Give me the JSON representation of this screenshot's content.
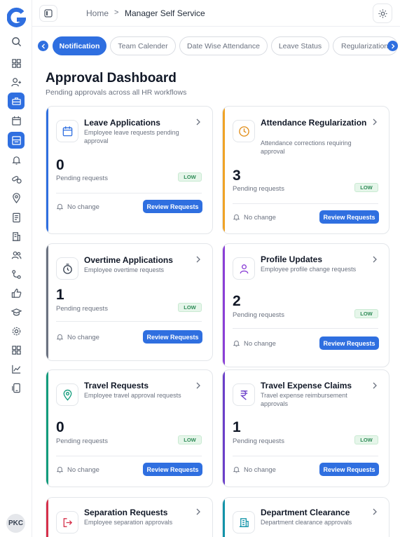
{
  "sidebar": {
    "logo_letter": "G",
    "avatar_initials": "PKC",
    "icons": [
      {
        "name": "search-icon"
      },
      {
        "name": "dashboard-icon"
      },
      {
        "name": "add-user-icon"
      },
      {
        "name": "briefcase-icon",
        "active": true
      },
      {
        "name": "calendar-icon"
      },
      {
        "name": "inbox-icon",
        "active": true
      },
      {
        "name": "bell-icon"
      },
      {
        "name": "pills-icon"
      },
      {
        "name": "location-icon"
      },
      {
        "name": "bill-icon"
      },
      {
        "name": "building-icon"
      },
      {
        "name": "team-icon"
      },
      {
        "name": "route-icon"
      },
      {
        "name": "thumbs-up-icon"
      },
      {
        "name": "graduation-cap-icon"
      },
      {
        "name": "settings-icon"
      },
      {
        "name": "grid-icon"
      },
      {
        "name": "chart-icon"
      },
      {
        "name": "device-icon"
      }
    ]
  },
  "header": {
    "breadcrumb_home": "Home",
    "breadcrumb_separator": ">",
    "breadcrumb_current": "Manager Self Service"
  },
  "tabs": [
    {
      "label": "Notification",
      "active": true
    },
    {
      "label": "Team Calender"
    },
    {
      "label": "Date Wise Attendance"
    },
    {
      "label": "Leave Status"
    },
    {
      "label": "Regularization"
    }
  ],
  "page": {
    "title": "Approval Dashboard",
    "subtitle": "Pending approvals across all HR workflows"
  },
  "colors": {
    "primary": "#2f6fe0",
    "low_badge_bg": "#e6f6ea",
    "low_badge_text": "#2e8b57"
  },
  "cards": [
    {
      "title": "Leave Applications",
      "description": "Employee leave requests pending approval",
      "count": "0",
      "count_label": "Pending requests",
      "badge": "LOW",
      "change": "No change",
      "button": "Review Requests",
      "accent": "#2f6fe0",
      "icon": "calendar-icon"
    },
    {
      "title": "Attendance Regularization",
      "description": "Attendance corrections requiring approval",
      "count": "3",
      "count_label": "Pending requests",
      "badge": "LOW",
      "change": "No change",
      "button": "Review Requests",
      "accent": "#f0a325",
      "icon": "clock-icon"
    },
    {
      "title": "Overtime Applications",
      "description": "Employee overtime requests",
      "count": "1",
      "count_label": "Pending requests",
      "badge": "LOW",
      "change": "No change",
      "button": "Review Requests",
      "accent": "#6b7280",
      "icon": "stopwatch-icon"
    },
    {
      "title": "Profile Updates",
      "description": "Employee profile change requests",
      "count": "2",
      "count_label": "Pending requests",
      "badge": "LOW",
      "change": "No change",
      "button": "Review Requests",
      "accent": "#8b3fd6",
      "icon": "user-icon"
    },
    {
      "title": "Travel Requests",
      "description": "Employee travel approval requests",
      "count": "0",
      "count_label": "Pending requests",
      "badge": "LOW",
      "change": "No change",
      "button": "Review Requests",
      "accent": "#129c7c",
      "icon": "map-pin-icon"
    },
    {
      "title": "Travel Expense Claims",
      "description": "Travel expense reimbursement approvals",
      "count": "1",
      "count_label": "Pending requests",
      "badge": "LOW",
      "change": "No change",
      "button": "Review Requests",
      "accent": "#6b3fc9",
      "icon": "rupee-icon"
    },
    {
      "title": "Separation Requests",
      "description": "Employee separation approvals",
      "accent": "#d6304a",
      "icon": "exit-icon"
    },
    {
      "title": "Department Clearance",
      "description": "Department clearance approvals",
      "accent": "#1293a8",
      "icon": "building-icon"
    }
  ]
}
